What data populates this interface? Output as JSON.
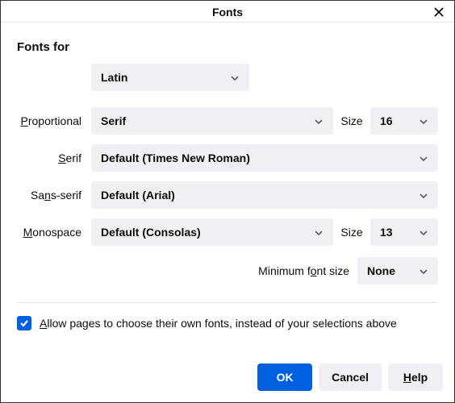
{
  "title": "Fonts",
  "heading": "Fonts for",
  "language": "Latin",
  "labels": {
    "proportional": "Proportional",
    "serif": "Serif",
    "sansSerif": "Sans-serif",
    "monospace": "Monospace",
    "size": "Size",
    "minimumFontSize": "Minimum font size"
  },
  "values": {
    "proportional": "Serif",
    "serif": "Default (Times New Roman)",
    "sansSerif": "Default (Arial)",
    "monospace": "Default (Consolas)",
    "proportionalSize": "16",
    "monospaceSize": "13",
    "minSize": "None"
  },
  "checkbox": {
    "checked": true,
    "label": "Allow pages to choose their own fonts, instead of your selections above"
  },
  "buttons": {
    "ok": "OK",
    "cancel": "Cancel",
    "help": "Help"
  }
}
